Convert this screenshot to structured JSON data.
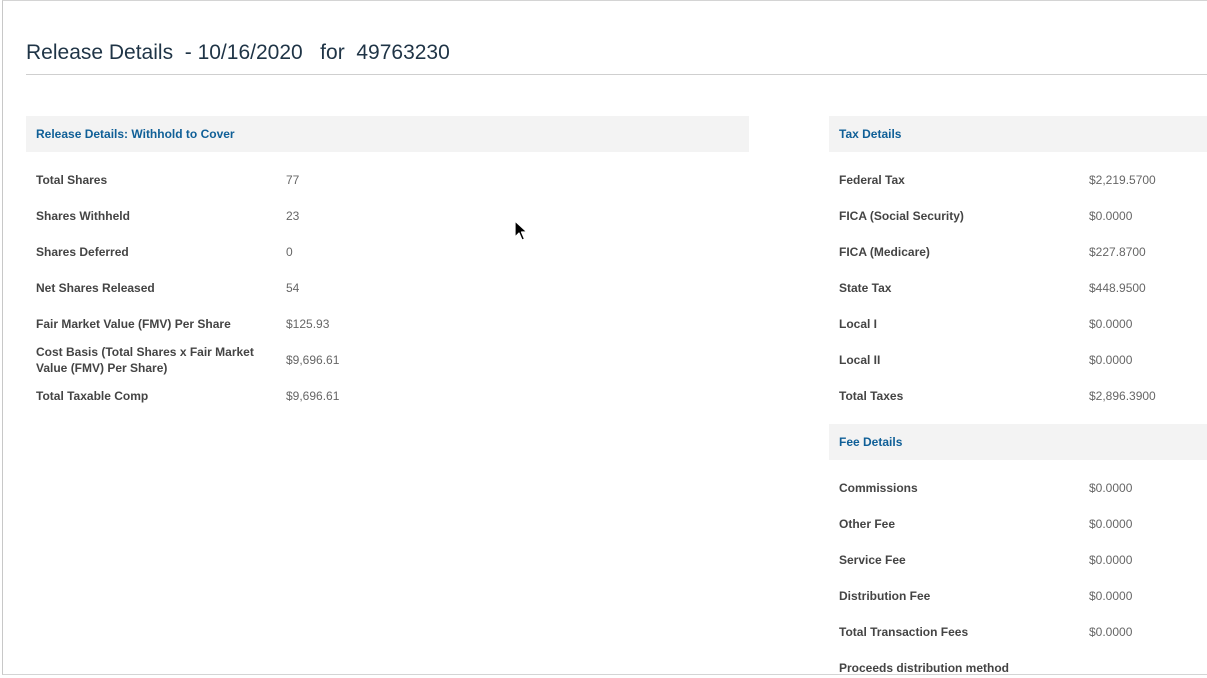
{
  "page": {
    "title": "Release Details  - 10/16/2020   for  49763230"
  },
  "release_panel": {
    "header": "Release Details: Withhold to Cover",
    "rows": [
      {
        "label": "Total Shares",
        "value": "77"
      },
      {
        "label": "Shares Withheld",
        "value": "23"
      },
      {
        "label": "Shares Deferred",
        "value": "0"
      },
      {
        "label": "Net Shares Released",
        "value": "54"
      },
      {
        "label": "Fair Market Value (FMV) Per Share",
        "value": "$125.93"
      },
      {
        "label": "Cost Basis (Total Shares x Fair Market Value (FMV) Per Share)",
        "value": "$9,696.61"
      },
      {
        "label": "Total Taxable Comp",
        "value": "$9,696.61"
      }
    ]
  },
  "tax_panel": {
    "header": "Tax Details",
    "rows": [
      {
        "label": "Federal Tax",
        "value": "$2,219.5700"
      },
      {
        "label": "FICA (Social Security)",
        "value": "$0.0000"
      },
      {
        "label": "FICA (Medicare)",
        "value": "$227.8700"
      },
      {
        "label": "State Tax",
        "value": "$448.9500"
      },
      {
        "label": "Local I",
        "value": "$0.0000"
      },
      {
        "label": "Local II",
        "value": "$0.0000"
      },
      {
        "label": "Total Taxes",
        "value": "$2,896.3900"
      }
    ]
  },
  "fee_panel": {
    "header": "Fee Details",
    "rows": [
      {
        "label": "Commissions",
        "value": "$0.0000"
      },
      {
        "label": "Other Fee",
        "value": "$0.0000"
      },
      {
        "label": "Service Fee",
        "value": "$0.0000"
      },
      {
        "label": "Distribution Fee",
        "value": "$0.0000"
      },
      {
        "label": "Total Transaction Fees",
        "value": "$0.0000"
      },
      {
        "label": "Proceeds distribution method",
        "value": ""
      }
    ]
  },
  "colors": {
    "header_text": "#0f5f97",
    "header_bg": "#f3f3f3",
    "title_text": "#1f3446"
  },
  "icons": {
    "cursor": "mouse-pointer-icon"
  }
}
